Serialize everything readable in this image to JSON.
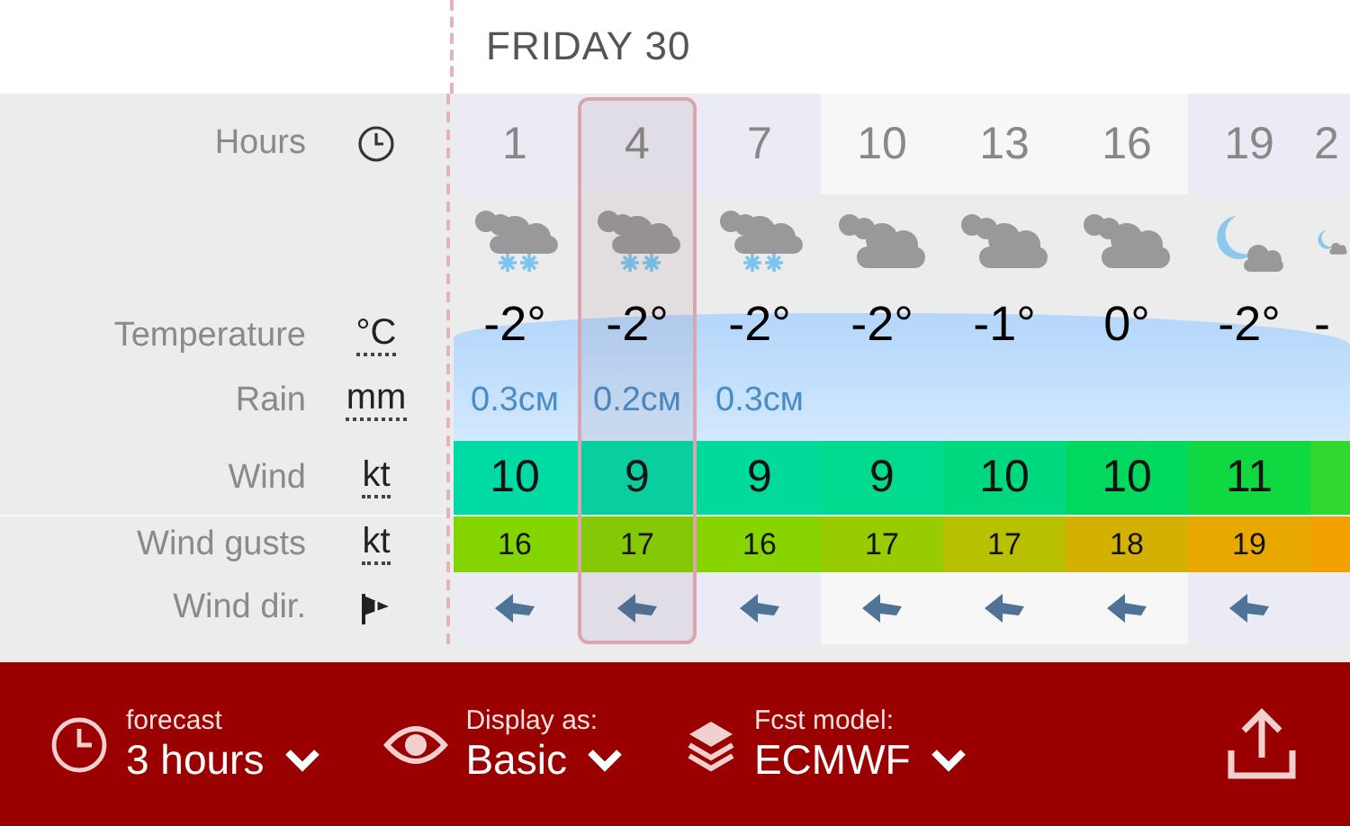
{
  "day_header": "FRIDAY 30",
  "row_labels": [
    {
      "kind": "hours",
      "label": "Hours"
    },
    {
      "kind": "temp",
      "label": "Temperature",
      "unit": "°C"
    },
    {
      "kind": "rain",
      "label": "Rain",
      "unit": "mm"
    },
    {
      "kind": "wind",
      "label": "Wind",
      "unit": "kt"
    },
    {
      "kind": "gust",
      "label": "Wind gusts",
      "unit": "kt"
    },
    {
      "kind": "dir",
      "label": "Wind dir."
    }
  ],
  "columns": [
    {
      "hour": "1",
      "night": true,
      "selected": false,
      "kind": "snow",
      "temp": "-2°",
      "rain": "0.3см",
      "wind": {
        "value": "10",
        "color": "#00dba6"
      },
      "gust": {
        "value": "16",
        "color": "#84d400"
      }
    },
    {
      "hour": "4",
      "night": true,
      "selected": true,
      "kind": "snow",
      "temp": "-2°",
      "rain": "0.2см",
      "wind": {
        "value": "9",
        "color": "#00dba6"
      },
      "gust": {
        "value": "17",
        "color": "#86d400"
      }
    },
    {
      "hour": "7",
      "night": true,
      "selected": false,
      "kind": "snow",
      "temp": "-2°",
      "rain": "0.3см",
      "wind": {
        "value": "9",
        "color": "#00db9c"
      },
      "gust": {
        "value": "16",
        "color": "#88d400"
      }
    },
    {
      "hour": "10",
      "night": false,
      "selected": false,
      "kind": "cloud",
      "temp": "-2°",
      "wind": {
        "value": "9",
        "color": "#00db90"
      },
      "gust": {
        "value": "17",
        "color": "#98cc00"
      }
    },
    {
      "hour": "13",
      "night": false,
      "selected": false,
      "kind": "cloud",
      "temp": "-1°",
      "wind": {
        "value": "10",
        "color": "#00d880"
      },
      "gust": {
        "value": "17",
        "color": "#b8c000"
      }
    },
    {
      "hour": "16",
      "night": false,
      "selected": false,
      "kind": "cloud",
      "temp": "0°",
      "wind": {
        "value": "10",
        "color": "#00d860"
      },
      "gust": {
        "value": "18",
        "color": "#d4b000"
      }
    },
    {
      "hour": "19",
      "night": true,
      "selected": false,
      "kind": "night-cloud",
      "temp": "-2°",
      "wind": {
        "value": "11",
        "color": "#10d840"
      },
      "gust": {
        "value": "19",
        "color": "#e8a800"
      }
    },
    {
      "hour": "2",
      "night": true,
      "selected": false,
      "kind": "night-cloud",
      "temp": "-",
      "wind": {
        "color": "#30d830"
      },
      "gust": {
        "color": "#f4a000"
      }
    }
  ],
  "footer": [
    {
      "kind": "clock",
      "caption": "forecast",
      "value": "3 hours"
    },
    {
      "kind": "eye",
      "caption": "Display as:",
      "value": "Basic"
    },
    {
      "kind": "layers",
      "caption": "Fcst model:",
      "value": "ECMWF"
    }
  ]
}
